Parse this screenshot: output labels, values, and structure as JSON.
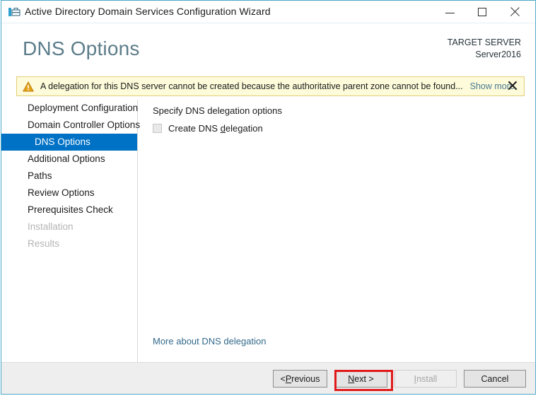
{
  "window": {
    "title": "Active Directory Domain Services Configuration Wizard",
    "icon": "server-wizard-icon",
    "controls": {
      "minimize": "minimize-icon",
      "maximize": "maximize-icon",
      "close": "close-icon"
    }
  },
  "header": {
    "page_title": "DNS Options",
    "target_server_label": "TARGET SERVER",
    "target_server_name": "Server2016"
  },
  "warning": {
    "icon": "warning-triangle-icon",
    "message": "A delegation for this DNS server cannot be created because the authoritative parent zone cannot be found...",
    "show_more_label": "Show more",
    "close_label": "close-icon",
    "background_color": "#fdfbd9",
    "border_color": "#e3cf7a"
  },
  "nav": {
    "selected_index": 2,
    "items": [
      {
        "label": "Deployment Configuration",
        "state": "enabled"
      },
      {
        "label": "Domain Controller Options",
        "state": "enabled"
      },
      {
        "label": "DNS Options",
        "state": "selected"
      },
      {
        "label": "Additional Options",
        "state": "enabled"
      },
      {
        "label": "Paths",
        "state": "enabled"
      },
      {
        "label": "Review Options",
        "state": "enabled"
      },
      {
        "label": "Prerequisites Check",
        "state": "enabled"
      },
      {
        "label": "Installation",
        "state": "disabled"
      },
      {
        "label": "Results",
        "state": "disabled"
      }
    ],
    "selected_color": "#0072c6"
  },
  "content": {
    "section_heading": "Specify DNS delegation options",
    "checkbox": {
      "label_before": "Create DNS ",
      "label_accel": "d",
      "label_after": "elegation",
      "checked": false,
      "enabled": false
    },
    "more_link": "More about DNS delegation"
  },
  "footer": {
    "buttons": [
      {
        "name": "previous",
        "prefix": "< ",
        "accel": "P",
        "suffix": "revious",
        "enabled": true
      },
      {
        "name": "next",
        "prefix": "",
        "accel": "N",
        "suffix": "ext >",
        "enabled": true
      },
      {
        "name": "install",
        "prefix": "",
        "accel": "I",
        "suffix": "nstall",
        "enabled": false
      },
      {
        "name": "cancel",
        "prefix": "",
        "accel": "",
        "suffix": "Cancel",
        "enabled": true
      }
    ]
  },
  "annotation": {
    "target": "next-button",
    "color": "#e01b1b"
  }
}
